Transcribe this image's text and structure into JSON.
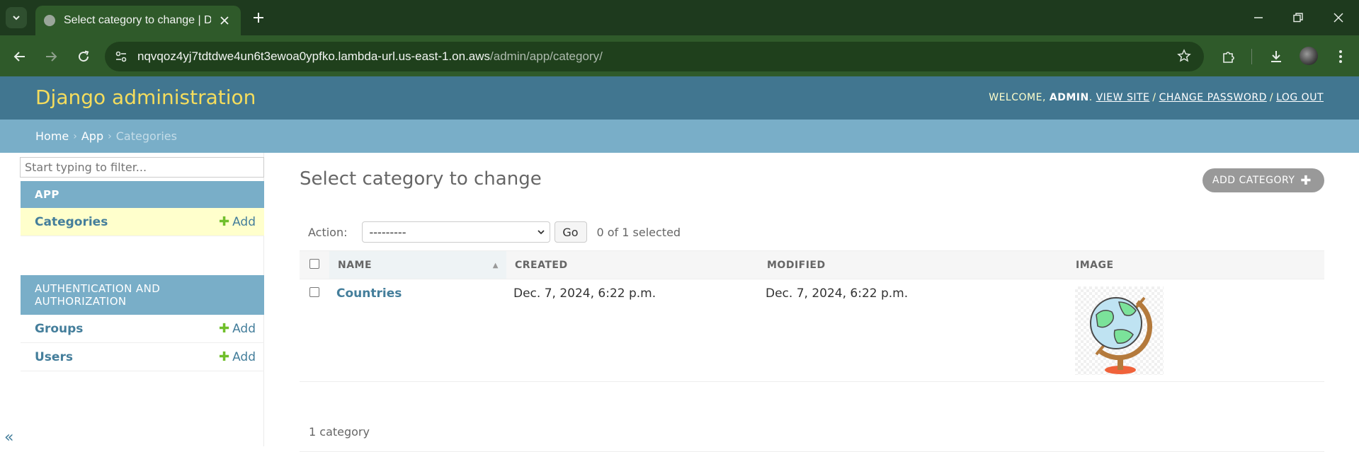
{
  "browser": {
    "tab_title": "Select category to change | Dja",
    "url_host": "nqvqoz4yj7tdtdwe4un6t3ewoa0ypfko.lambda-url.us-east-1.on.aws",
    "url_path": "/admin/app/category/"
  },
  "header": {
    "branding": "Django administration",
    "welcome": "WELCOME,",
    "username": "ADMIN",
    "view_site": "VIEW SITE",
    "change_password": "CHANGE PASSWORD",
    "log_out": "LOG OUT"
  },
  "breadcrumbs": {
    "home": "Home",
    "app": "App",
    "current": "Categories",
    "separator": "›"
  },
  "sidebar": {
    "filter_placeholder": "Start typing to filter...",
    "modules": [
      {
        "caption": "APP",
        "models": [
          {
            "name": "Categories",
            "add": "Add"
          }
        ]
      },
      {
        "caption": "AUTHENTICATION AND AUTHORIZATION",
        "models": [
          {
            "name": "Groups",
            "add": "Add"
          },
          {
            "name": "Users",
            "add": "Add"
          }
        ]
      }
    ],
    "collapse_glyph": "«"
  },
  "content": {
    "title": "Select category to change",
    "add_button": "ADD CATEGORY",
    "action_label": "Action:",
    "action_selected": "---------",
    "go_label": "Go",
    "selection_counter": "0 of 1 selected",
    "columns": [
      "NAME",
      "CREATED",
      "MODIFIED",
      "IMAGE"
    ],
    "rows": [
      {
        "name": "Countries",
        "created": "Dec. 7, 2024, 6:22 p.m.",
        "modified": "Dec. 7, 2024, 6:22 p.m.",
        "image_icon": "globe-icon"
      }
    ],
    "paginator": "1 category"
  },
  "colors": {
    "header": "#417690",
    "branding": "#f5dd5d",
    "breadcrumbs": "#79aec8",
    "link": "#447e9b",
    "add_plus": "#70bf2b",
    "chrome_dark": "#1e3a1e",
    "chrome_toolbar": "#2f5a2a"
  }
}
